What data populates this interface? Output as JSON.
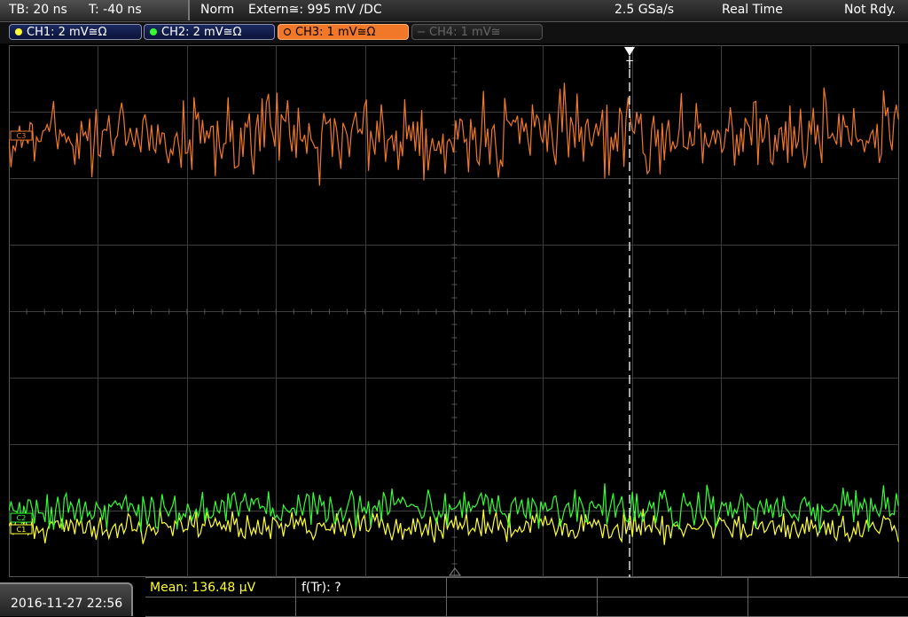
{
  "topbar": {
    "timebase": "TB: 20 ns",
    "trigger_time": "T: -40 ns",
    "mode": "Norm",
    "trigger_source": "Extern≅: 995 mV ∕DC",
    "sample_rate": "2.5 GSa/s",
    "acquisition": "Real Time",
    "status": "Not Rdy."
  },
  "channels": [
    {
      "label": "CH1: 2 mV≅Ω",
      "color": "#ffff33"
    },
    {
      "label": "CH2: 2 mV≅Ω",
      "color": "#33ff33"
    },
    {
      "label": "CH3: 1 mV≅Ω",
      "color": "#f07828"
    },
    {
      "label": "CH4: 1 mV≅",
      "color": "#555555"
    }
  ],
  "markers": {
    "ch3": "C3",
    "ch2": "C2",
    "ch1": "C1",
    "trigger": "T"
  },
  "measurements": {
    "mean": "Mean: 136.48 µV",
    "ftr": "f(Tr): ?"
  },
  "datetime": "2016-11-27  22:56",
  "colors": {
    "grid": "#3c3c3c",
    "ch1": "#ffff33",
    "ch2": "#33ff33",
    "ch3": "#f07828",
    "measurement_text": "#ffff33"
  }
}
